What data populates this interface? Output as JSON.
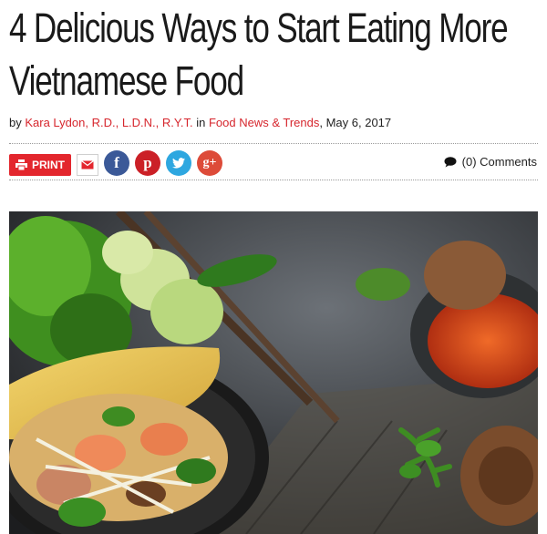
{
  "article": {
    "title": "4 Delicious Ways to Start Eating More Vietnamese Food",
    "byline": {
      "by": "by",
      "author": "Kara Lydon, R.D., L.D.N., R.Y.T.",
      "in": "in",
      "category": "Food News & Trends",
      "date": ", May 6, 2017"
    }
  },
  "share": {
    "print_label": "PRINT",
    "icons": [
      "email-icon",
      "facebook-icon",
      "pinterest-icon",
      "twitter-icon",
      "google-plus-icon"
    ],
    "facebook_glyph": "f",
    "pinterest_glyph": "p",
    "google_glyph": "g+",
    "comments_label": "(0) Comments"
  },
  "colors": {
    "brand_red": "#e3262d",
    "link_red": "#d6262d",
    "facebook": "#3b5998",
    "pinterest": "#cb2027",
    "twitter": "#2ea7e0",
    "google_plus": "#dd4b39"
  }
}
